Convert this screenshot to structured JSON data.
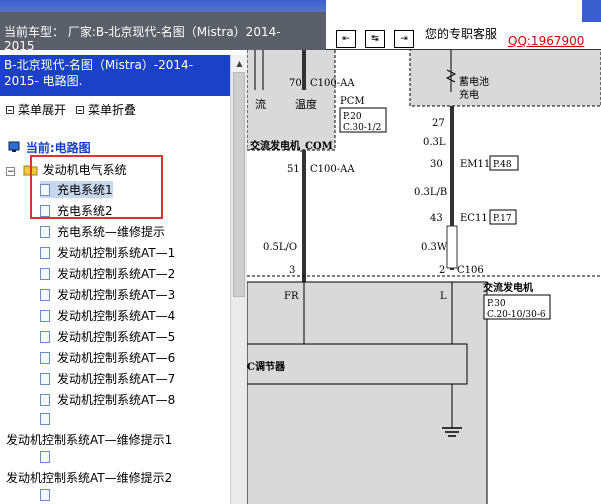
{
  "header": {
    "car_title": "当前车型： 厂家:B-北京现代-名图（Mistra）2014-2015",
    "service_text": "您的专职客服",
    "qq_link": "QQ:1967900",
    "nav_buttons": [
      "⇤",
      "↹",
      "⇥"
    ]
  },
  "sidebar": {
    "title": "B-北京现代-名图（Mistra）-2014-2015- 电路图.",
    "expand_label": "菜单展开",
    "collapse_label": "菜单折叠",
    "current_label": "当前:电路图",
    "group_label": "发动机电气系统",
    "items": [
      "充电系统1",
      "充电系统2",
      "充电系统—维修提示",
      "发动机控制系统AT—1",
      "发动机控制系统AT—2",
      "发动机控制系统AT—3",
      "发动机控制系统AT—4",
      "发动机控制系统AT—5",
      "发动机控制系统AT—6",
      "发动机控制系统AT—7",
      "发动机控制系统AT—8"
    ],
    "extra_items": [
      "发动机控制系统AT—维修提示1",
      "发动机控制系统AT—维修提示2"
    ]
  },
  "diagram": {
    "labels": {
      "pin70": "70",
      "c100aa_top": "C100-AA",
      "liu": "流",
      "wendu": "温度",
      "pcm": "PCM",
      "p20": "P.20",
      "c30": "C.30-1/2",
      "alt_com": "交流发电机_COM",
      "pin51": "51",
      "c100aa_mid": "C100-AA",
      "w05lo": "0.5L/O",
      "pin3": "3",
      "fr": "FR",
      "battery_l1": "蓄电池",
      "battery_l2": "充电",
      "pin27": "27",
      "w03l": "0.3L",
      "pin30": "30",
      "em11": "EM11",
      "p48": "P.48",
      "w03lb": "0.3L/B",
      "pin43": "43",
      "ec11": "EC11",
      "p17": "P.17",
      "w03w": "0.3W",
      "pin2": "2",
      "c106": "C106",
      "l": "L",
      "alternator": "交流发电机",
      "p30": "P.30",
      "c20": "C.20-10/30-6",
      "regulator": "C调节器"
    }
  }
}
